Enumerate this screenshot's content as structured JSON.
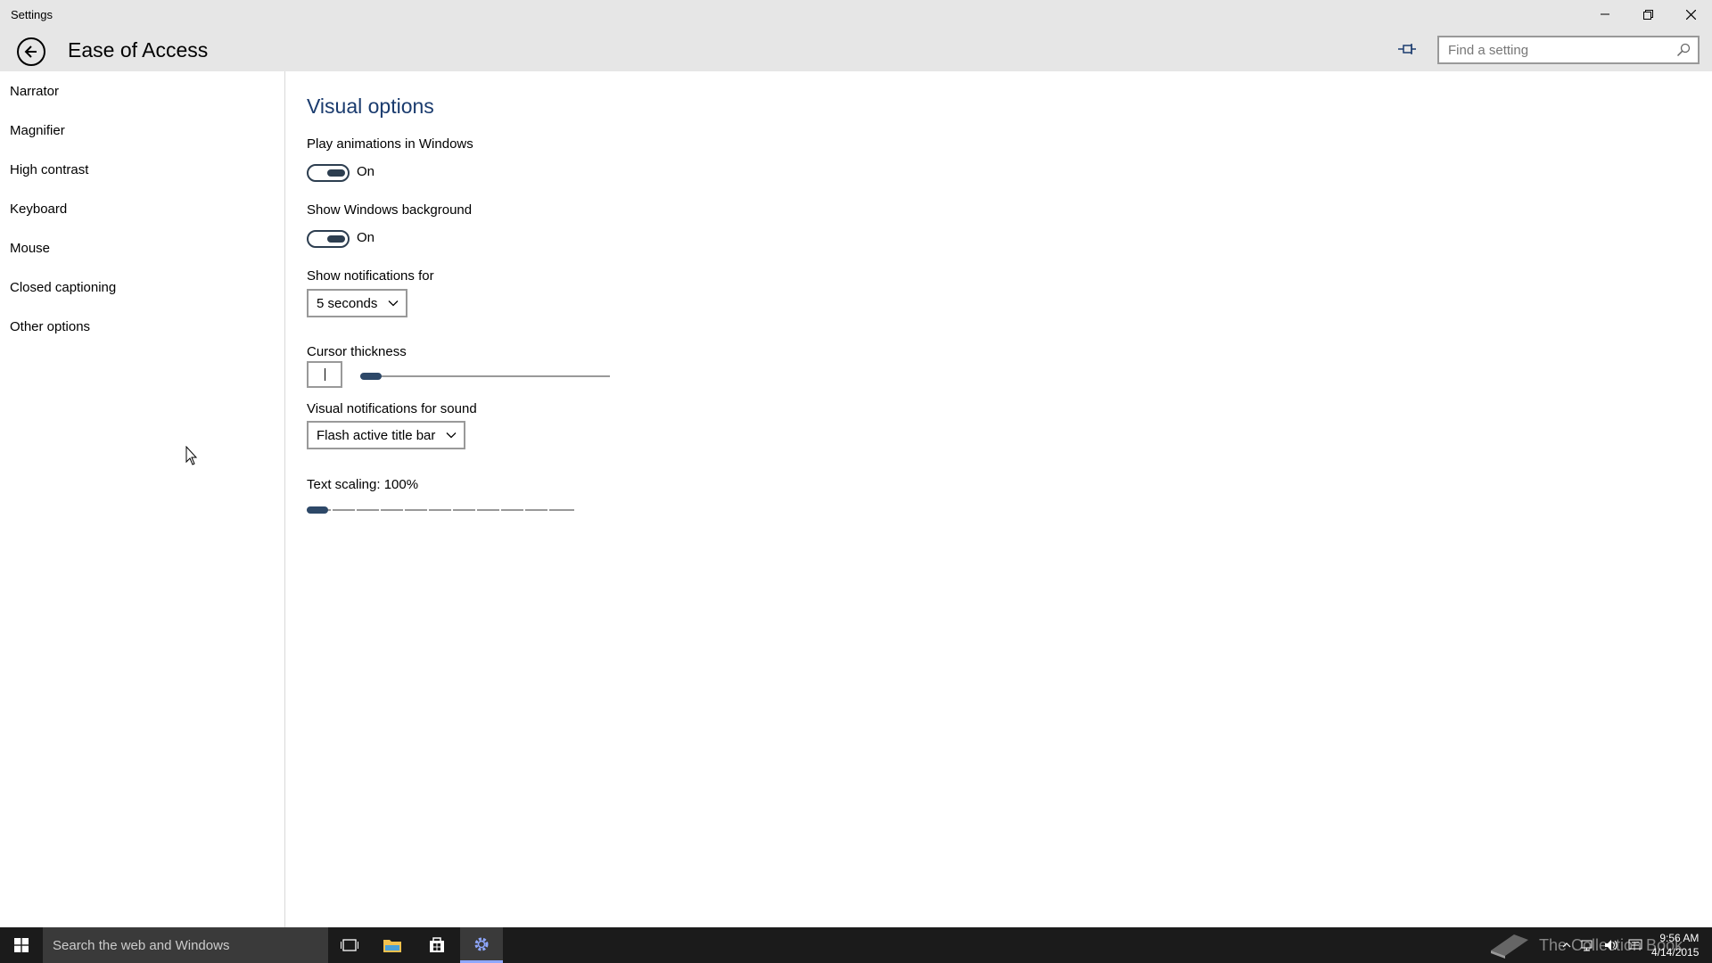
{
  "window": {
    "title": "Settings"
  },
  "header": {
    "page_title": "Ease of Access",
    "search_placeholder": "Find a setting"
  },
  "sidebar": {
    "items": [
      {
        "label": "Narrator"
      },
      {
        "label": "Magnifier"
      },
      {
        "label": "High contrast"
      },
      {
        "label": "Keyboard"
      },
      {
        "label": "Mouse"
      },
      {
        "label": "Closed captioning"
      },
      {
        "label": "Other options"
      }
    ]
  },
  "main": {
    "section_title": "Visual options",
    "animations": {
      "label": "Play animations in Windows",
      "state": "On"
    },
    "background": {
      "label": "Show Windows background",
      "state": "On"
    },
    "notifications": {
      "label": "Show notifications for",
      "value": "5 seconds"
    },
    "cursor": {
      "label": "Cursor thickness",
      "value_fraction": 0.0
    },
    "sound": {
      "label": "Visual notifications for sound",
      "value": "Flash active title bar"
    },
    "text_scaling": {
      "label": "Text scaling: 100%",
      "value_fraction": 0.0
    }
  },
  "taskbar": {
    "search_text": "Search the web and Windows",
    "watermark": "The Collection Book",
    "time": "9:56 AM",
    "date": "4/14/2015"
  },
  "colors": {
    "accent": "#1a3b6e",
    "toggle": "#2d3e50",
    "taskbar": "#1b1b1b"
  },
  "icons": {
    "back": "back-arrow-icon",
    "pin": "pin-icon",
    "search": "search-icon",
    "minimize": "minimize-icon",
    "restore": "restore-icon",
    "close": "close-icon",
    "start": "windows-logo-icon",
    "task_view": "task-view-icon",
    "explorer": "file-explorer-icon",
    "store": "store-icon",
    "settings": "gear-icon"
  }
}
